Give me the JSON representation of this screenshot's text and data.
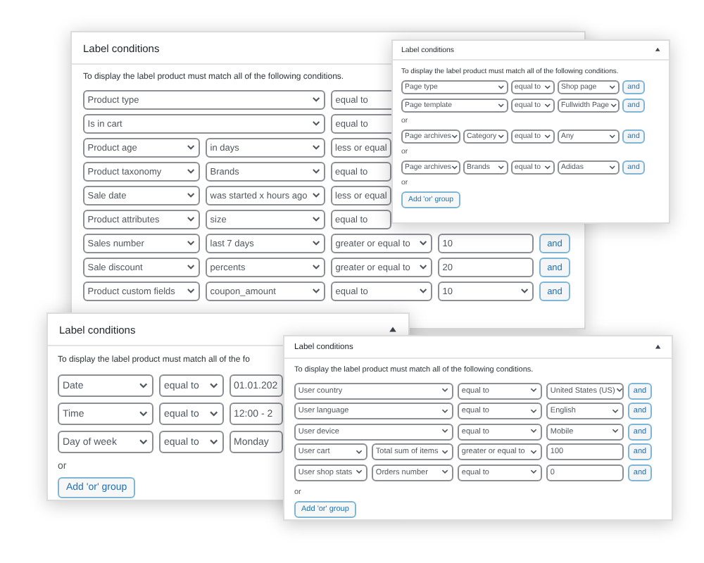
{
  "panels": [
    {
      "title": "Label conditions",
      "description": "To display the label product must match all of the following conditions.",
      "items": [
        {
          "kind": "wide",
          "cells": [
            {
              "text": "Product type",
              "kind": "select"
            },
            {
              "text": "equal to",
              "kind": "select"
            }
          ]
        },
        {
          "kind": "wide",
          "cells": [
            {
              "text": "Is in cart",
              "kind": "select"
            },
            {
              "text": "equal to",
              "kind": "select"
            }
          ]
        },
        {
          "kind": "split",
          "cells": [
            {
              "text": "Product age",
              "kind": "select"
            },
            {
              "text": "in days",
              "kind": "select"
            },
            {
              "text": "less or equal",
              "kind": "select"
            }
          ]
        },
        {
          "kind": "split",
          "cells": [
            {
              "text": "Product taxonomy",
              "kind": "select"
            },
            {
              "text": "Brands",
              "kind": "select"
            },
            {
              "text": "equal to",
              "kind": "select"
            }
          ]
        },
        {
          "kind": "split",
          "cells": [
            {
              "text": "Sale date",
              "kind": "select"
            },
            {
              "text": "was started x hours ago",
              "kind": "select"
            },
            {
              "text": "less or equal",
              "kind": "select"
            }
          ]
        },
        {
          "kind": "split",
          "cells": [
            {
              "text": "Product attributes",
              "kind": "select"
            },
            {
              "text": "size",
              "kind": "select"
            },
            {
              "text": "equal to",
              "kind": "select"
            }
          ]
        },
        {
          "kind": "split",
          "cells": [
            {
              "text": "Sales number",
              "kind": "select"
            },
            {
              "text": "last 7 days",
              "kind": "select"
            },
            {
              "text": "greater or equal to",
              "kind": "select"
            },
            {
              "text": "10",
              "kind": "input"
            }
          ],
          "button": "and"
        },
        {
          "kind": "split",
          "cells": [
            {
              "text": "Sale discount",
              "kind": "select"
            },
            {
              "text": "percents",
              "kind": "select"
            },
            {
              "text": "greater or equal to",
              "kind": "select"
            },
            {
              "text": "20",
              "kind": "input"
            }
          ],
          "button": "and"
        },
        {
          "kind": "split",
          "cells": [
            {
              "text": "Product custom fields",
              "kind": "select"
            },
            {
              "text": "coupon_amount",
              "kind": "select"
            },
            {
              "text": "equal to",
              "kind": "select"
            },
            {
              "text": "10",
              "kind": "select"
            }
          ],
          "button": "and"
        }
      ]
    },
    {
      "title": "Label conditions",
      "description": "To display the label product must match all of the following conditions.",
      "items": [
        {
          "kind": "wide",
          "cells": [
            {
              "text": "Page type",
              "kind": "select"
            },
            {
              "text": "equal to",
              "kind": "select"
            },
            {
              "text": "Shop page",
              "kind": "select"
            }
          ],
          "button": "and"
        },
        {
          "kind": "wide",
          "cells": [
            {
              "text": "Page template",
              "kind": "select"
            },
            {
              "text": "equal to",
              "kind": "select"
            },
            {
              "text": "Fullwidth Page",
              "kind": "select"
            }
          ],
          "button": "and"
        },
        {
          "kind": "or",
          "text": "or"
        },
        {
          "kind": "split",
          "cells": [
            {
              "text": "Page archives",
              "kind": "select"
            },
            {
              "text": "Category",
              "kind": "select"
            },
            {
              "text": "equal to",
              "kind": "select"
            },
            {
              "text": "Any",
              "kind": "select"
            }
          ],
          "button": "and"
        },
        {
          "kind": "or",
          "text": "or"
        },
        {
          "kind": "split",
          "cells": [
            {
              "text": "Page archives",
              "kind": "select"
            },
            {
              "text": "Brands",
              "kind": "select"
            },
            {
              "text": "equal to",
              "kind": "select"
            },
            {
              "text": "Adidas",
              "kind": "select"
            }
          ],
          "button": "and"
        },
        {
          "kind": "or",
          "text": "or"
        },
        {
          "kind": "button",
          "text": "Add 'or' group"
        }
      ]
    },
    {
      "title": "Label conditions",
      "description": "To display the label product must match all of the fo",
      "items": [
        {
          "kind": "split",
          "cells": [
            {
              "text": "Date",
              "kind": "select"
            },
            {
              "text": "equal to",
              "kind": "select"
            },
            {
              "text": "01.01.202",
              "kind": "input"
            }
          ]
        },
        {
          "kind": "split",
          "cells": [
            {
              "text": "Time",
              "kind": "select"
            },
            {
              "text": "equal to",
              "kind": "select"
            },
            {
              "text": "12:00 - 2",
              "kind": "input"
            }
          ]
        },
        {
          "kind": "split",
          "cells": [
            {
              "text": "Day of week",
              "kind": "select"
            },
            {
              "text": "equal to",
              "kind": "select"
            },
            {
              "text": "Monday",
              "kind": "input"
            }
          ]
        },
        {
          "kind": "or",
          "text": "or"
        },
        {
          "kind": "button",
          "text": "Add 'or' group"
        }
      ]
    },
    {
      "title": "Label conditions",
      "description": "To display the label product must match all of the following conditions.",
      "items": [
        {
          "kind": "wide",
          "cells": [
            {
              "text": "User country",
              "kind": "select"
            },
            {
              "text": "equal to",
              "kind": "select"
            },
            {
              "text": "United States (US)",
              "kind": "select"
            }
          ],
          "button": "and"
        },
        {
          "kind": "wide",
          "cells": [
            {
              "text": "User language",
              "kind": "select"
            },
            {
              "text": "equal to",
              "kind": "select"
            },
            {
              "text": "English",
              "kind": "select"
            }
          ],
          "button": "and"
        },
        {
          "kind": "wide",
          "cells": [
            {
              "text": "User device",
              "kind": "select"
            },
            {
              "text": "equal to",
              "kind": "select"
            },
            {
              "text": "Mobile",
              "kind": "select"
            }
          ],
          "button": "and"
        },
        {
          "kind": "split",
          "cells": [
            {
              "text": "User cart",
              "kind": "select"
            },
            {
              "text": "Total sum of items",
              "kind": "select"
            },
            {
              "text": "greater or equal to",
              "kind": "select"
            },
            {
              "text": "100",
              "kind": "input"
            }
          ],
          "button": "and"
        },
        {
          "kind": "split",
          "cells": [
            {
              "text": "User shop stats",
              "kind": "select"
            },
            {
              "text": "Orders number",
              "kind": "select"
            },
            {
              "text": "equal to",
              "kind": "select"
            },
            {
              "text": "0",
              "kind": "input"
            }
          ],
          "button": "and"
        },
        {
          "kind": "or",
          "text": "or"
        },
        {
          "kind": "button",
          "text": "Add 'or' group"
        }
      ]
    }
  ]
}
